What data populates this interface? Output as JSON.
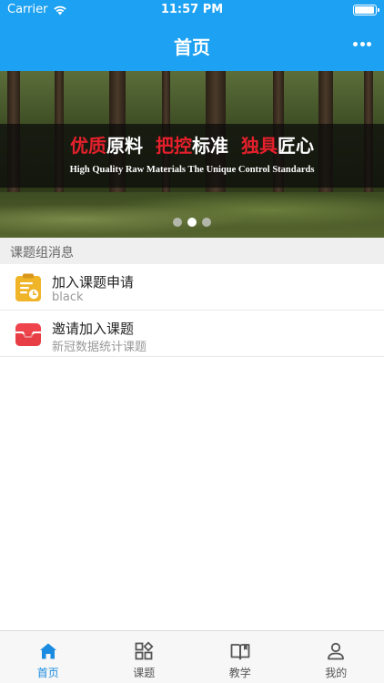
{
  "status_bar": {
    "carrier": "Carrier",
    "time": "11:57 PM",
    "battery_level": 0.95
  },
  "nav": {
    "title": "首页",
    "more_icon": "more-icon"
  },
  "banner": {
    "headline_parts": [
      "优质",
      "原料",
      "把控",
      "标准",
      "独具",
      "匠心"
    ],
    "subtitle": "High Quality Raw Materials The Unique Control Standards",
    "page_count": 3,
    "active_page": 1
  },
  "section": {
    "title": "课题组消息"
  },
  "messages": [
    {
      "icon": "clipboard-clock-icon",
      "title": "加入课题申请",
      "subtitle": "black",
      "color": "#f0b429"
    },
    {
      "icon": "inbox-icon",
      "title": "邀请加入课题",
      "subtitle": "新冠数据统计课题",
      "color": "#f0444c"
    }
  ],
  "tabs": [
    {
      "label": "首页",
      "icon": "home-icon",
      "active": true
    },
    {
      "label": "课题",
      "icon": "grid-icon",
      "active": false
    },
    {
      "label": "教学",
      "icon": "book-icon",
      "active": false
    },
    {
      "label": "我的",
      "icon": "person-icon",
      "active": false
    }
  ],
  "colors": {
    "primary": "#1da1f2",
    "tab_active": "#1a8be0",
    "tab_inactive": "#555555",
    "accent_red": "#e5202c"
  }
}
